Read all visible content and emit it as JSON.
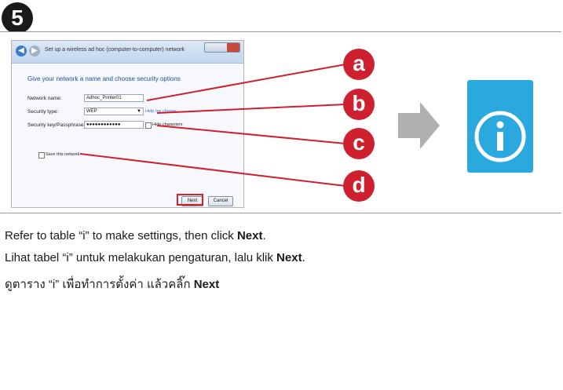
{
  "step_number": "5",
  "screenshot": {
    "window_title": "Set up a wireless ad hoc (computer-to-computer) network",
    "heading": "Give your network a name and choose security options",
    "network_name_label": "Network name:",
    "network_name_value": "Adhoc_Printer01",
    "security_type_label": "Security type:",
    "security_type_value": "WEP",
    "security_key_label": "Security key/Passphrase:",
    "security_key_value": "●●●●●●●●●●●●",
    "help_link": "Help me choose",
    "hide_characters_label": "Hide characters",
    "save_network_label": "Save this network",
    "next_button": "Next",
    "cancel_button": "Cancel"
  },
  "callouts": [
    "a",
    "b",
    "c",
    "d"
  ],
  "colors": {
    "callout": "#cf2030",
    "arrow": "#b0b0b0",
    "info_card": "#2aa9df"
  },
  "instructions": {
    "en_prefix": "Refer to table “i” to make settings, then click ",
    "en_bold": "Next",
    "en_suffix": ".",
    "id_prefix": "Lihat tabel “i” untuk melakukan pengaturan, lalu klik ",
    "id_bold": "Next",
    "id_suffix": ".",
    "th_prefix": "ดูตาราง “i” เพื่อทำการตั้งค่า แล้วคลิ๊ก ",
    "th_bold": "Next"
  }
}
